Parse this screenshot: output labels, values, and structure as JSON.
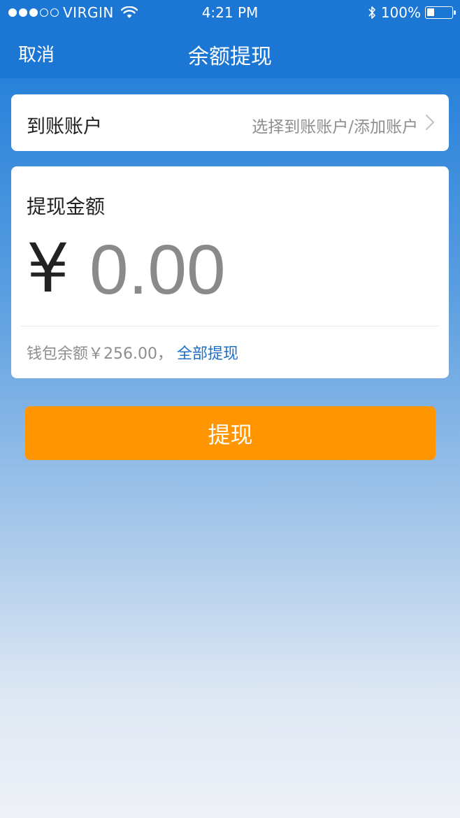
{
  "status_bar": {
    "carrier": "VIRGIN",
    "time": "4:21 PM",
    "battery_text": "100%",
    "battery_level": 0.3,
    "signal_dots": 5,
    "signal_filled": 3
  },
  "nav": {
    "cancel_label": "取消",
    "title": "余额提现"
  },
  "account": {
    "label": "到账账户",
    "value": "选择到账账户/添加账户"
  },
  "amount": {
    "label": "提现金额",
    "currency": "¥",
    "placeholder": "0.00"
  },
  "balance": {
    "text": "钱包余额￥256.00，",
    "withdraw_all": "全部提现"
  },
  "submit": {
    "label": "提现"
  },
  "colors": {
    "nav": "#1b76d4",
    "button": "#ff9500",
    "link": "#1f6fc6"
  }
}
